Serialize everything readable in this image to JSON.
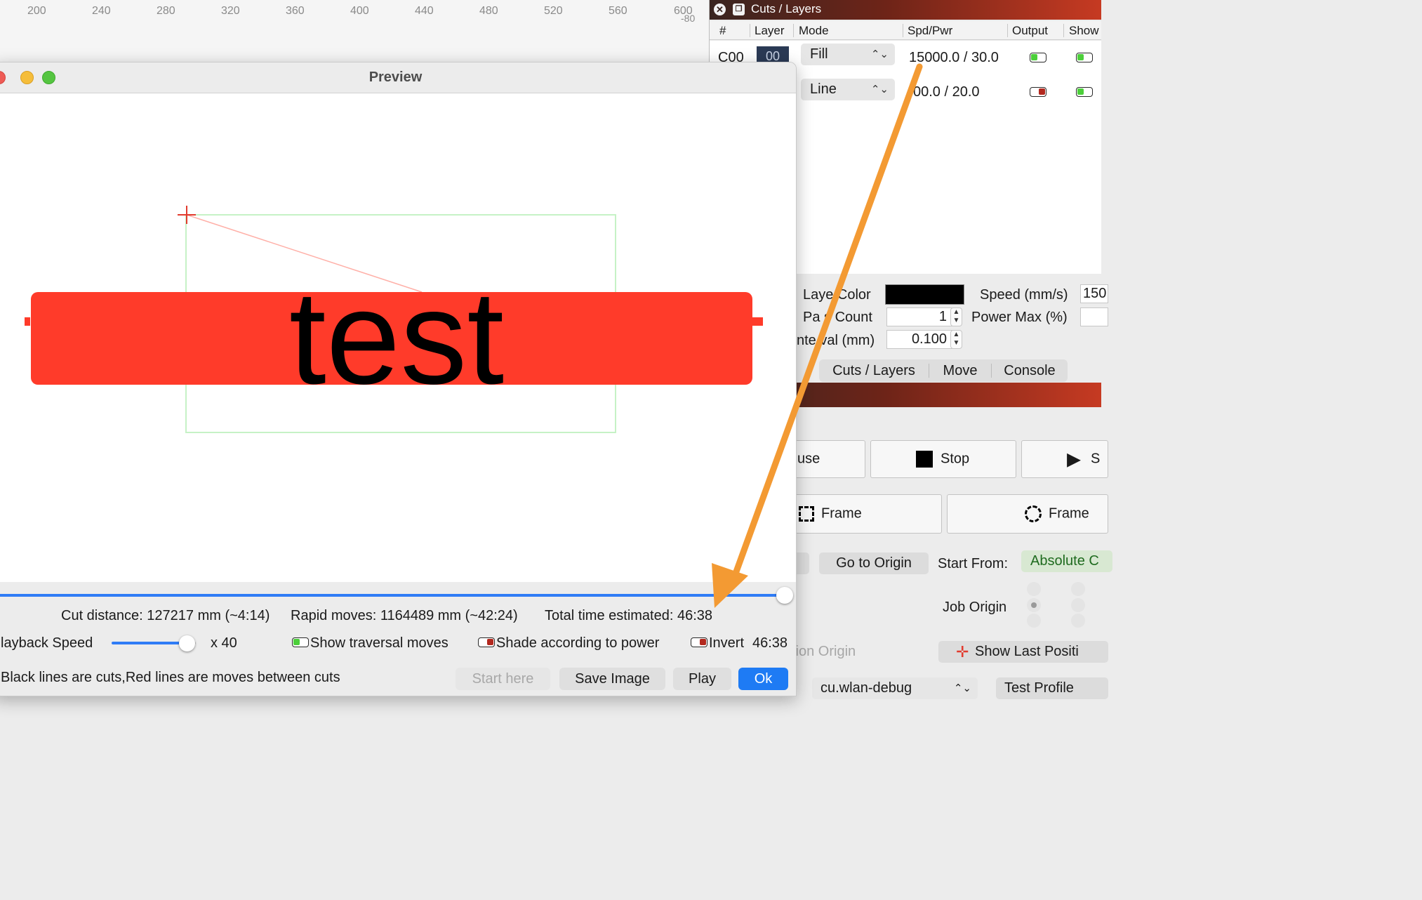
{
  "ruler": {
    "ticks": [
      "200",
      "240",
      "280",
      "320",
      "360",
      "400",
      "440",
      "480",
      "520",
      "560",
      "600"
    ],
    "vertical_tick": "-80"
  },
  "layers_dock": {
    "title": "Cuts / Layers",
    "columns": [
      "#",
      "Layer",
      "Mode",
      "Spd/Pwr",
      "Output",
      "Show"
    ],
    "rows": [
      {
        "id": "C00",
        "layer": "00",
        "mode": "Fill",
        "spd_pwr": "15000.0 / 30.0",
        "output": true,
        "show": true
      },
      {
        "id": "",
        "layer": "",
        "mode": "Line",
        "spd_pwr": "00.0 / 20.0",
        "output": false,
        "show": true
      }
    ],
    "properties": {
      "layer_color_label": "Laye  Color",
      "layer_color": "#000000",
      "pass_count_label": "Pa s Count",
      "pass_count": "1",
      "interval_label": "nte val (mm)",
      "interval": "0.100",
      "speed_label": "Speed (mm/s)",
      "speed_value": "150",
      "power_max_label": "Power Max (%)"
    },
    "tabs": [
      "Cuts / Layers",
      "Move",
      "Console"
    ],
    "active_tab": "Move"
  },
  "laser_panel": {
    "pause_label": "use",
    "stop_label": "Stop",
    "start_label": "S",
    "frame1_label": "Frame",
    "frame2_label": "Frame",
    "go_to_origin_label": "Go to Origin",
    "start_from_label": "Start From:",
    "start_from_value": "Absolute C",
    "job_origin_label": "Job Origin",
    "action_origin_label": "tion Origin",
    "show_last_position_label": "Show Last Positi",
    "device_select": "cu.wlan-debug",
    "test_profile_label": "Test Profile"
  },
  "preview": {
    "title": "Preview",
    "canvas_text": "test",
    "cut_distance": "Cut distance: 127217 mm (~4:14)",
    "rapid_moves": "Rapid moves: 1164489 mm (~42:24)",
    "total_time": "Total time estimated: 46:38",
    "playback_label": "layback Speed",
    "playback_value": "x 40",
    "playback_fraction": 0.92,
    "timeline_fraction": 1.0,
    "show_traversal_label": "Show traversal moves",
    "show_traversal": true,
    "shade_power_label": "Shade according to power",
    "shade_power": false,
    "invert_label": "Invert",
    "invert": false,
    "elapsed": "46:38",
    "hint": "Black lines are cuts,Red lines are moves between cuts",
    "buttons": {
      "start_here": "Start here",
      "save_image": "Save Image",
      "play": "Play",
      "ok": "Ok"
    }
  },
  "colors": {
    "accent_blue": "#1e7bf4",
    "fill_red": "#ff3b2a",
    "toggle_on": "#4ccf3a",
    "toggle_off": "#b3281e",
    "annotation_arrow": "#f39a33"
  }
}
